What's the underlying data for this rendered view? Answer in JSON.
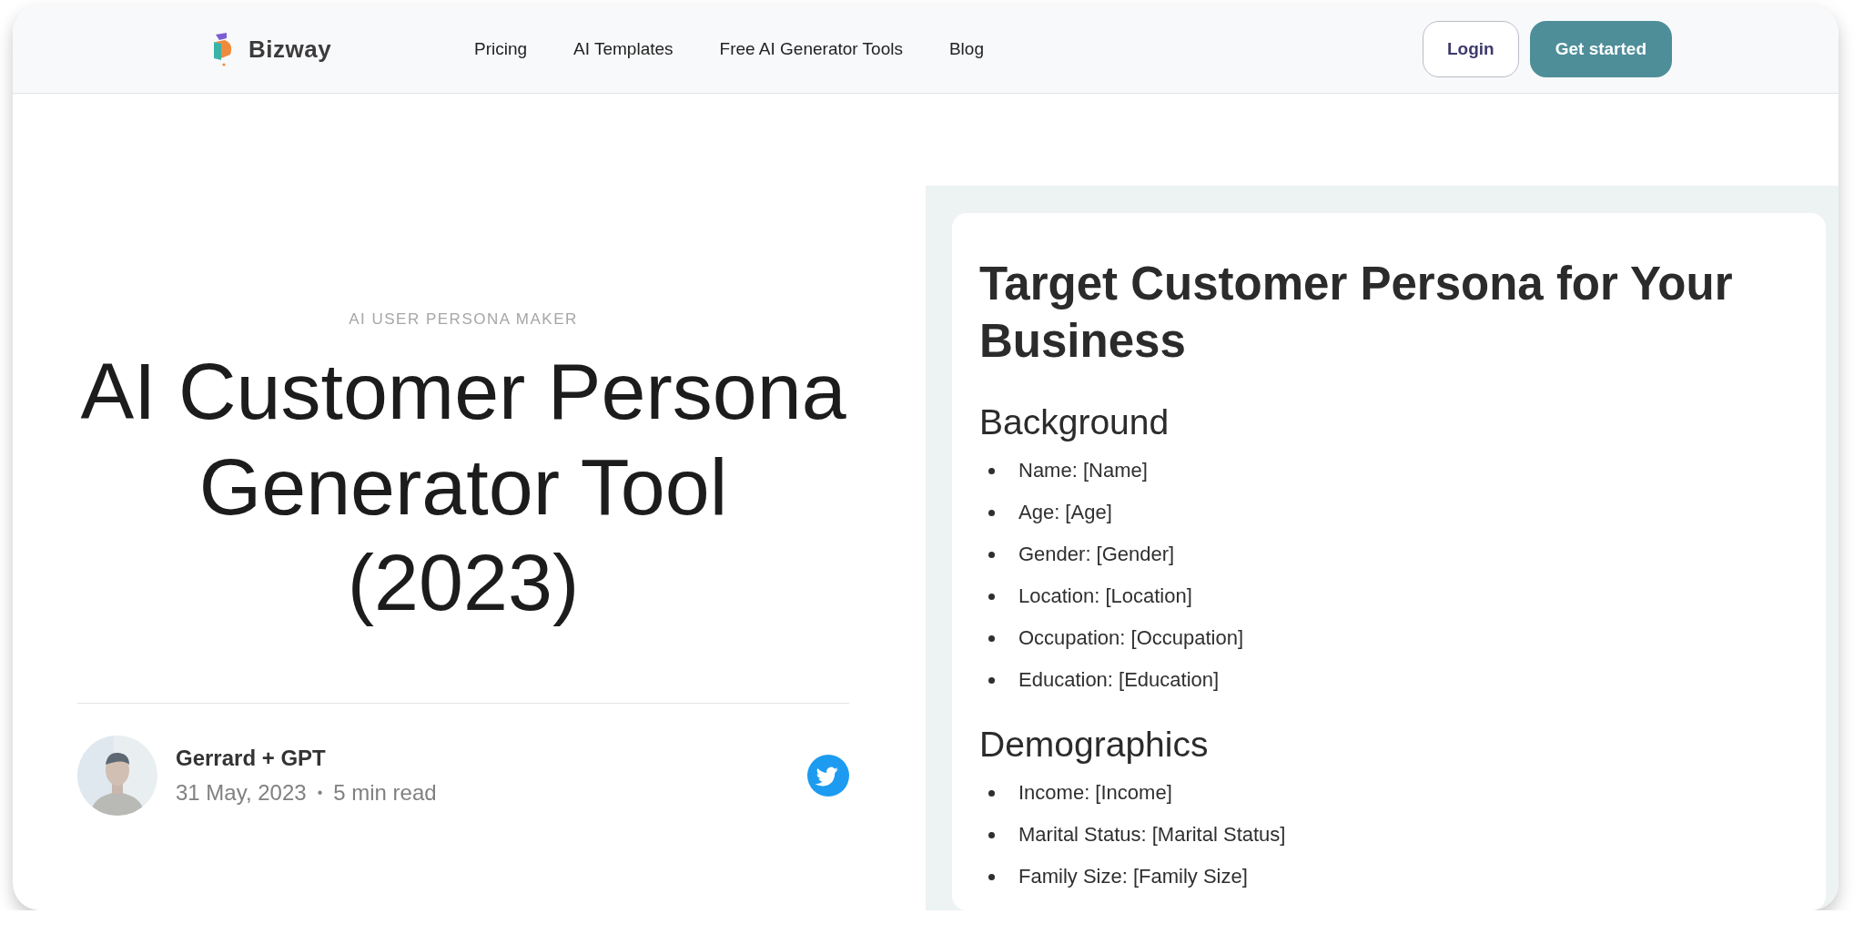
{
  "header": {
    "logo": "Bizway",
    "nav": [
      {
        "label": "Pricing"
      },
      {
        "label": "AI Templates"
      },
      {
        "label": "Free AI Generator Tools"
      },
      {
        "label": "Blog"
      }
    ],
    "buttons": [
      {
        "label": "Login",
        "kind": "outline"
      },
      {
        "label": "Get started",
        "kind": "primary"
      }
    ]
  },
  "article": {
    "eyebrow": "AI USER PERSONA MAKER",
    "title": "AI Customer Persona Generator Tool (2023)",
    "author": "Gerrard + GPT",
    "date": "31 May, 2023",
    "separator": "•",
    "read_time": "5 min read"
  },
  "preview": {
    "heading": "Target Customer Persona for Your Business",
    "sections": [
      {
        "title": "Background",
        "items": [
          "Name: [Name]",
          "Age: [Age]",
          "Gender: [Gender]",
          "Location: [Location]",
          "Occupation: [Occupation]",
          "Education: [Education]"
        ]
      },
      {
        "title": "Demographics",
        "items": [
          "Income: [Income]",
          "Marital Status: [Marital Status]",
          "Family Size: [Family Size]"
        ]
      }
    ]
  }
}
